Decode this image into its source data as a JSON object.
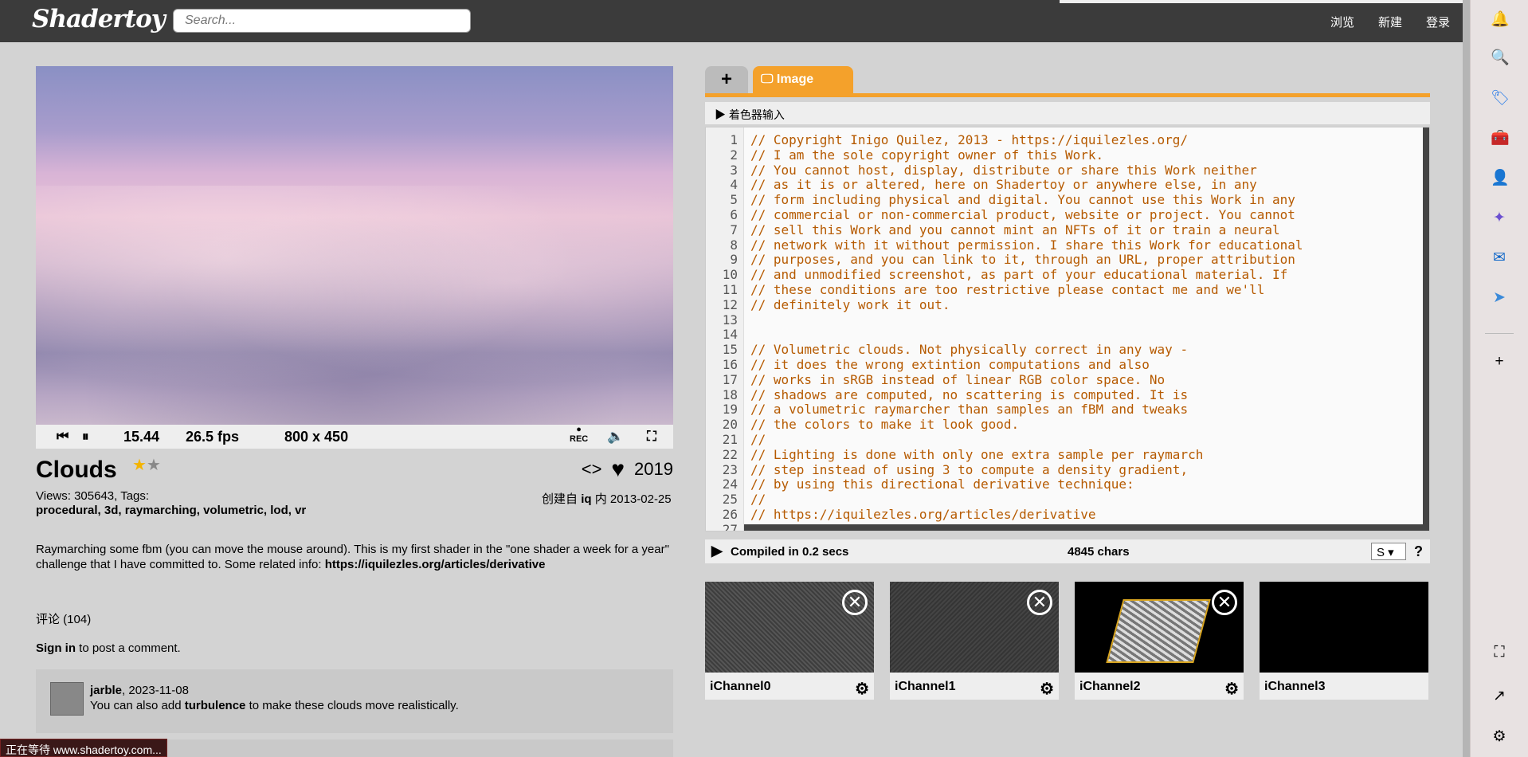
{
  "nav": {
    "logo": "Shadertoy",
    "search_placeholder": "Search...",
    "links": [
      "浏览",
      "新建",
      "登录"
    ]
  },
  "player": {
    "time": "15.44",
    "fps": "26.5 fps",
    "resolution": "800 x 450",
    "rec_label": "REC"
  },
  "shader": {
    "title": "Clouds",
    "likes": "2019",
    "views": "Views: 305643, Tags:",
    "tags": "procedural, 3d, raymarching, volumetric, lod, vr",
    "created_prefix": "创建自",
    "author": "iq",
    "created_mid": "内",
    "date": "2013-02-25",
    "description": "Raymarching some fbm (you can move the mouse around). This is my first shader in the \"one shader a week for a year\" challenge that I have committed to. Some related info:",
    "link": "https://iquilezles.org/articles/derivative"
  },
  "comments": {
    "count": "评论 (104)",
    "signin": "Sign in",
    "signin_rest": " to post a comment.",
    "items": [
      {
        "user": "jarble",
        "date": ", 2023-11-08",
        "pre": "You can also add ",
        "bold": "turbulence",
        "post": " to make these clouds move realistically."
      }
    ]
  },
  "status": "正在等待 www.shadertoy.com...",
  "editor": {
    "tab_plus": "+",
    "tab_image": "Image",
    "inputs_label": "着色器输入",
    "lines": [
      "// Copyright Inigo Quilez, 2013 - https://iquilezles.org/",
      "// I am the sole copyright owner of this Work.",
      "// You cannot host, display, distribute or share this Work neither",
      "// as it is or altered, here on Shadertoy or anywhere else, in any",
      "// form including physical and digital. You cannot use this Work in any",
      "// commercial or non-commercial product, website or project. You cannot",
      "// sell this Work and you cannot mint an NFTs of it or train a neural",
      "// network with it without permission. I share this Work for educational",
      "// purposes, and you can link to it, through an URL, proper attribution",
      "// and unmodified screenshot, as part of your educational material. If",
      "// these conditions are too restrictive please contact me and we'll",
      "// definitely work it out.",
      "",
      "",
      "// Volumetric clouds. Not physically correct in any way -",
      "// it does the wrong extintion computations and also",
      "// works in sRGB instead of linear RGB color space. No",
      "// shadows are computed, no scattering is computed. It is",
      "// a volumetric raymarcher than samples an fBM and tweaks",
      "// the colors to make it look good.",
      "//",
      "// Lighting is done with only one extra sample per raymarch",
      "// step instead of using 3 to compute a density gradient,",
      "// by using this directional derivative technique:",
      "//",
      "// https://iquilezles.org/articles/derivative",
      ""
    ],
    "compiled": "Compiled in 0.2 secs",
    "chars": "4845 chars",
    "font_select": "S",
    "help": "?"
  },
  "channels": [
    {
      "label": "iChannel0",
      "bg": "#4a4a4a"
    },
    {
      "label": "iChannel1",
      "bg": "#3c3c3c"
    },
    {
      "label": "iChannel2",
      "bg": "#000000"
    },
    {
      "label": "iChannel3",
      "bg": "#000000"
    }
  ],
  "colors": {
    "accent": "#f4a12b",
    "code": "#b65a00"
  }
}
